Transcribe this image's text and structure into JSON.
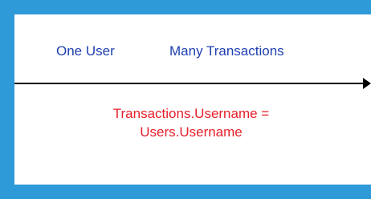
{
  "relationship": {
    "left_label": "One User",
    "right_label": "Many Transactions",
    "join_condition": {
      "line1": "Transactions.Username =",
      "line2": "Users.Username"
    }
  },
  "colors": {
    "background": "#2f9ad8",
    "panel": "#ffffff",
    "label_text": "#1f3fb0",
    "join_text": "#e8202a",
    "line": "#000000"
  }
}
